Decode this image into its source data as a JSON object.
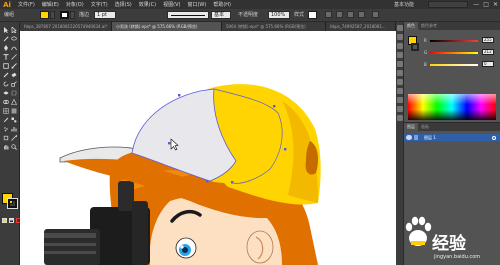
{
  "app": {
    "logo": "Ai",
    "workspace": "基本功能"
  },
  "menu": [
    "文件(F)",
    "编辑(E)",
    "对象(O)",
    "文字(T)",
    "选择(S)",
    "效果(C)",
    "视图(V)",
    "窗口(W)",
    "帮助(H)"
  ],
  "window_controls": [
    "—",
    "□",
    "✕"
  ],
  "control_bar": {
    "selection_label": "编组",
    "stroke_label": "描边",
    "stroke_value": "1 pt",
    "stroke_style": "基本",
    "opacity_label": "不透明度",
    "opacity_value": "100%",
    "style_label": "样式"
  },
  "tabs": [
    {
      "label": "hbps_387807 2018081520574940634.ai*",
      "active": false
    },
    {
      "label": "小男孩 (转换).eps* @ 575.66% (RGB/预览)",
      "active": true
    },
    {
      "label": "5064 (转换).eps* @ 575.66% (RGB/预览)",
      "active": false
    },
    {
      "label": "hbps_74992587_2018081...",
      "active": false
    }
  ],
  "colors": {
    "fill": "#ffd400",
    "stroke": "#222222",
    "accent_blue": "#2f5fa8",
    "cap_yellow": "#ffd400",
    "cap_light": "#e5e5e5",
    "hair_orange": "#e46d00",
    "skin": "#fde0c2"
  },
  "color_panel": {
    "tabs": [
      "颜色",
      "颜色参考"
    ],
    "channels": [
      {
        "name": "R",
        "value": "255",
        "track": "#ff3b3b"
      },
      {
        "name": "G",
        "value": "212",
        "track": "#26d12e"
      },
      {
        "name": "B",
        "value": "0",
        "track": "#2c6cff"
      }
    ]
  },
  "layers_panel": {
    "tabs": [
      "图层",
      "画板"
    ],
    "layer_name": "图层 1"
  },
  "watermark": {
    "text": "经验",
    "url": "jingyan.baidu.com"
  }
}
